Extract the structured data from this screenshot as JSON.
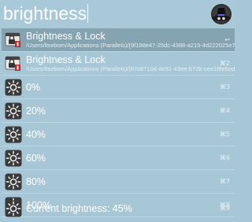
{
  "search": {
    "query": "brightness"
  },
  "colors": {
    "background": "#a7c7d7",
    "selected": "#86a3b1",
    "text": "#ffffff"
  },
  "results": [
    {
      "title": "Brightness & Lock",
      "subtitle": "/Users/ltsebom/Applications (Parallels)/{9f198e47-25dc-4388-a215-4d222025e7...",
      "shortcut": "↩",
      "icon": "lock-app-icon"
    },
    {
      "title": "Brightness & Lock",
      "subtitle": "/Users/ltsebom/Applications (Parallels)/{67c6710d-4e91-43ee-b72b-cee1f8e6ed3...",
      "shortcut": "⌘2",
      "icon": "lock-app-icon"
    },
    {
      "title": "0%",
      "shortcut": "⌘3",
      "icon": "sun-icon"
    },
    {
      "title": "20%",
      "shortcut": "⌘4",
      "icon": "sun-icon"
    },
    {
      "title": "40%",
      "shortcut": "⌘5",
      "icon": "sun-icon"
    },
    {
      "title": "60%",
      "shortcut": "⌘6",
      "icon": "sun-icon"
    },
    {
      "title": "80%",
      "shortcut": "⌘7",
      "icon": "sun-icon"
    },
    {
      "title": "100%",
      "shortcut": "⌘8",
      "icon": "sun-icon"
    },
    {
      "title": "Current brightness: 45%",
      "shortcut": "⌘9",
      "icon": "sun-icon"
    }
  ]
}
